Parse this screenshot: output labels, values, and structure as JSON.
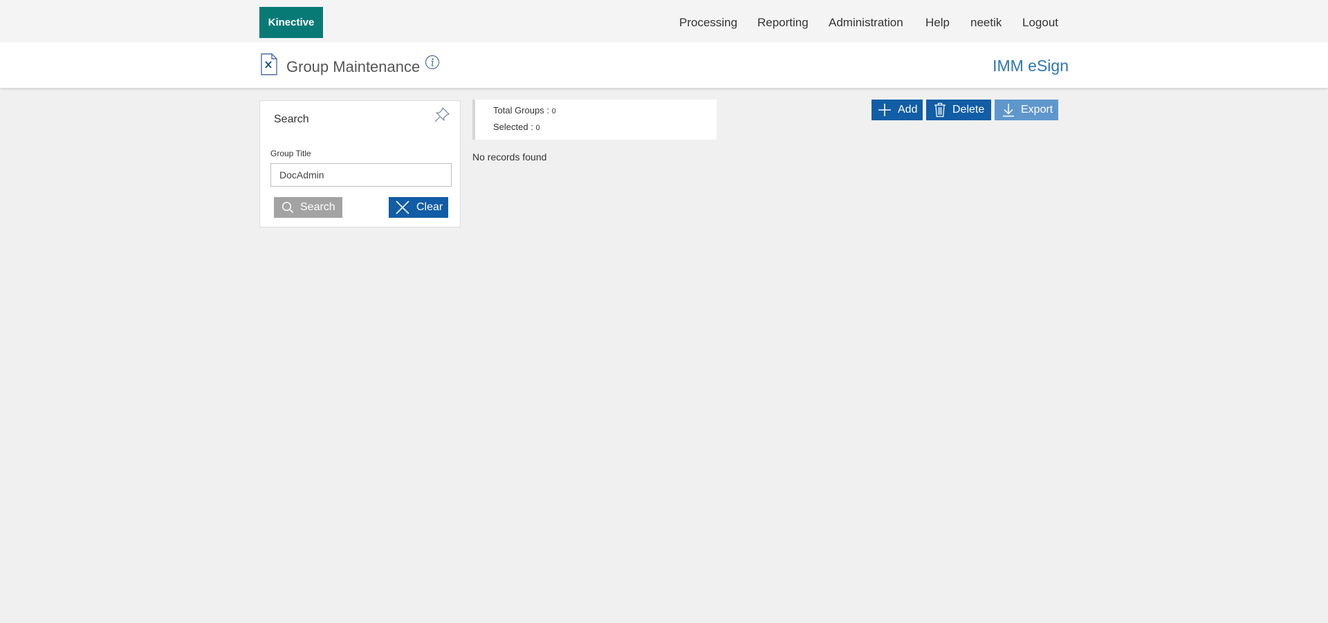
{
  "topbar": {
    "logo": "Kinective",
    "nav": [
      "Processing",
      "Reporting",
      "Administration",
      "Help",
      "neetik",
      "Logout"
    ]
  },
  "header": {
    "page_title": "Group Maintenance",
    "app_name": "IMM eSign",
    "icons": {
      "page": "document-x-icon",
      "info": "info-icon"
    }
  },
  "search_panel": {
    "title": "Search",
    "field_label": "Group Title",
    "field_value": "DocAdmin",
    "search_button": "Search",
    "clear_button": "Clear",
    "icons": {
      "pin": "pin-icon",
      "search": "search-icon",
      "clear": "close-icon"
    }
  },
  "summary": {
    "total_label": "Total Groups :",
    "total_value": "0",
    "selected_label": "Selected :",
    "selected_value": "0"
  },
  "results": {
    "empty_message": "No records found"
  },
  "toolbar": {
    "add_label": "Add",
    "delete_label": "Delete",
    "export_label": "Export",
    "icons": {
      "add": "plus-icon",
      "delete": "trash-icon",
      "export": "download-icon"
    }
  },
  "colors": {
    "brand": "#087a76",
    "primary_button": "#115da6",
    "export_button": "#5f97cd",
    "disabled_button": "#a3a3a3",
    "app_name": "#2e74b5",
    "background": "#f0f0f0"
  }
}
